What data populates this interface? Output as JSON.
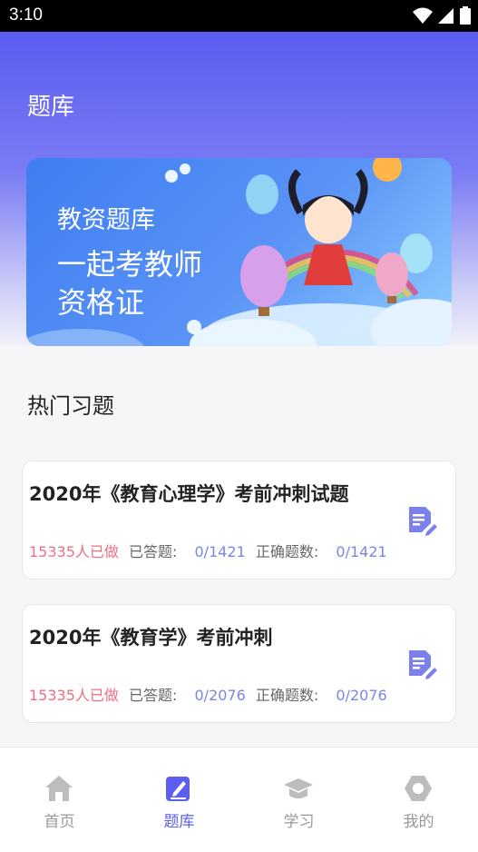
{
  "status_bar": {
    "time": "3:10"
  },
  "header": {
    "title": "题库"
  },
  "banner": {
    "line1": "教资题库",
    "line2": "一起考教师",
    "line3": "资格证"
  },
  "section": {
    "title": "热门习题"
  },
  "cards": [
    {
      "title": "2020年《教育心理学》考前冲刺试题",
      "done": "15335人已做",
      "answered_label": "已答题:",
      "answered_value": "0/1421",
      "correct_label": "正确题数:",
      "correct_value": "0/1421"
    },
    {
      "title": "2020年《教育学》考前冲刺",
      "done": "15335人已做",
      "answered_label": "已答题:",
      "answered_value": "0/2076",
      "correct_label": "正确题数:",
      "correct_value": "0/2076"
    }
  ],
  "tabbar": {
    "items": [
      {
        "label": "首页",
        "icon": "home-icon"
      },
      {
        "label": "题库",
        "icon": "question-bank-icon",
        "active": true
      },
      {
        "label": "学习",
        "icon": "graduation-cap-icon"
      },
      {
        "label": "我的",
        "icon": "profile-icon"
      }
    ]
  },
  "colors": {
    "accent": "#5b5ef0",
    "done_text": "#ee6f83",
    "value_text": "#7d84e8"
  }
}
